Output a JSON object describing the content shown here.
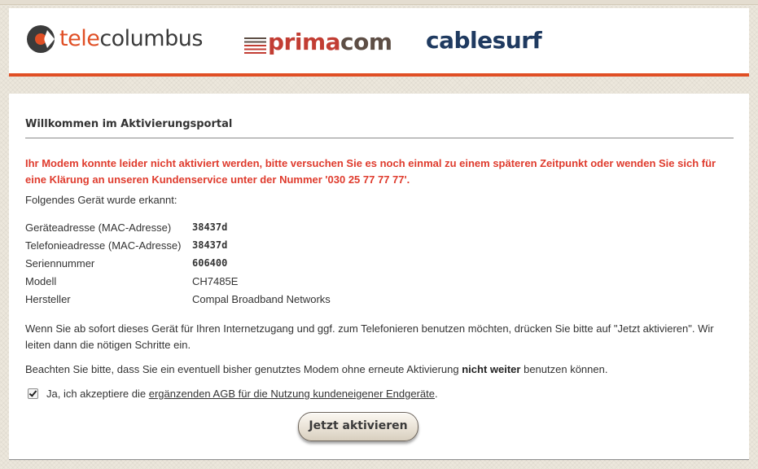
{
  "brands": {
    "telecolumbus": {
      "part1": "tele",
      "part2": "columbus"
    },
    "primacom": {
      "part1": "prima",
      "part2": "com"
    },
    "cablesurf": {
      "text": "cablesurf"
    }
  },
  "colors": {
    "accent": "#e04f25",
    "error": "#df3b2d",
    "cablesurf_blue": "#1f3a60"
  },
  "page": {
    "title": "Willkommen im Aktivierungsportal",
    "error_message": "Ihr Modem konnte leider nicht aktiviert werden, bitte versuchen Sie es noch einmal zu einem späteren Zeitpunkt oder wenden Sie sich für eine Klärung an unseren Kundenservice unter der Nummer '030 25 77 77 77'.",
    "detected_label": "Folgendes Gerät wurde erkannt:"
  },
  "device": [
    {
      "label": "Geräteadresse (MAC-Adresse)",
      "value": "38437d",
      "mono": true
    },
    {
      "label": "Telefonieadresse (MAC-Adresse)",
      "value": "38437d",
      "mono": true
    },
    {
      "label": "Seriennummer",
      "value": "606400",
      "mono": true
    },
    {
      "label": "Modell",
      "value": "CH7485E",
      "mono": false
    },
    {
      "label": "Hersteller",
      "value": "Compal Broadband Networks",
      "mono": false
    }
  ],
  "instructions": {
    "para1": "Wenn Sie ab sofort dieses Gerät für Ihren Internetzugang und ggf. zum Telefonieren benutzen möchten, drücken Sie bitte auf \"Jetzt aktivieren\". Wir leiten dann die nötigen Schritte ein.",
    "para2_pre": "Beachten Sie bitte, dass Sie ein eventuell bisher genutztes Modem ohne erneute Aktivierung ",
    "para2_bold": "nicht weiter",
    "para2_post": " benutzen können."
  },
  "agb": {
    "checked": true,
    "pre": "Ja, ich akzeptiere die ",
    "link": "ergänzenden AGB für die Nutzung kundeneigener Endgeräte",
    "post": "."
  },
  "actions": {
    "activate_label": "Jetzt aktivieren"
  }
}
